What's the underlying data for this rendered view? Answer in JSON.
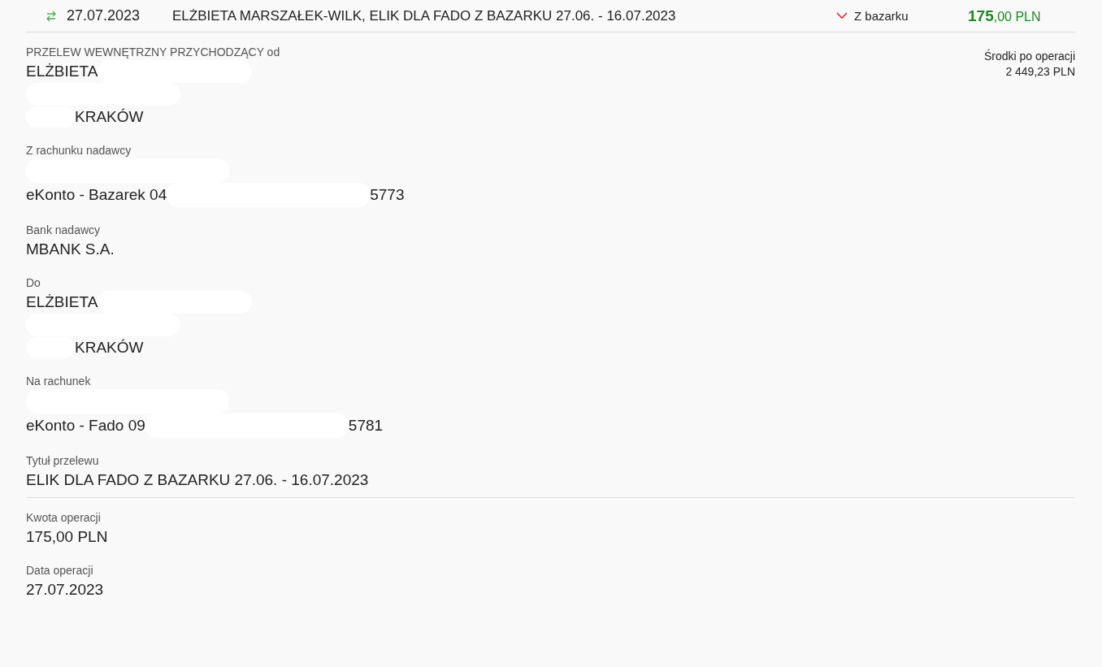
{
  "transaction": {
    "date": "27.07.2023",
    "title": "ELŻBIETA MARSZAŁEK-WILK, ELIK DLA FADO Z BAZARKU 27.06. - 16.07.2023",
    "account": "Z bazarku",
    "expanded": true,
    "amount_main": "175",
    "amount_rest": ",00 PLN"
  },
  "balance": {
    "label": "Środki po operacji",
    "value": "2 449,23 PLN"
  },
  "sections": [
    {
      "fields": [
        {
          "label": "PRZELEW WEWNĘTRZNY PRZYCHODZĄCY od",
          "lines": [
            [
              {
                "kind": "text",
                "text": "ELŻBIETA"
              },
              {
                "kind": "redaction"
              }
            ],
            [
              {
                "kind": "redaction"
              }
            ],
            [
              {
                "kind": "short_redaction"
              },
              {
                "kind": "text",
                "text": "KRAKÓW"
              }
            ]
          ]
        },
        {
          "label": "Z rachunku nadawcy",
          "lines": [
            [
              {
                "kind": "long_redaction"
              }
            ],
            [
              {
                "kind": "text",
                "text": "eKonto - Bazarek 04"
              },
              {
                "kind": "long_redaction"
              },
              {
                "kind": "text",
                "text": "5773"
              }
            ]
          ]
        },
        {
          "label": "Bank nadawcy",
          "lines": [
            [
              {
                "kind": "text",
                "text": "MBANK S.A."
              }
            ]
          ]
        },
        {
          "label": "Do",
          "lines": [
            [
              {
                "kind": "text",
                "text": "ELŻBIETA"
              },
              {
                "kind": "redaction"
              }
            ],
            [
              {
                "kind": "redaction"
              }
            ],
            [
              {
                "kind": "short_redaction"
              },
              {
                "kind": "text",
                "text": "KRAKÓW"
              }
            ]
          ]
        },
        {
          "label": "Na rachunek",
          "lines": [
            [
              {
                "kind": "long_redaction"
              }
            ],
            [
              {
                "kind": "text",
                "text": "eKonto - Fado 09"
              },
              {
                "kind": "long_redaction"
              },
              {
                "kind": "text",
                "text": "5781"
              }
            ]
          ]
        },
        {
          "label": "Tytuł przelewu",
          "lines": [
            [
              {
                "kind": "text",
                "text": "ELIK DLA FADO Z BAZARKU 27.06. - 16.07.2023"
              }
            ]
          ]
        }
      ]
    },
    {
      "fields": [
        {
          "label": "Kwota operacji",
          "lines": [
            [
              {
                "kind": "text",
                "text": "175,00 PLN"
              }
            ]
          ]
        },
        {
          "label": "Data operacji",
          "lines": [
            [
              {
                "kind": "text",
                "text": "27.07.2023"
              }
            ]
          ]
        }
      ]
    }
  ]
}
